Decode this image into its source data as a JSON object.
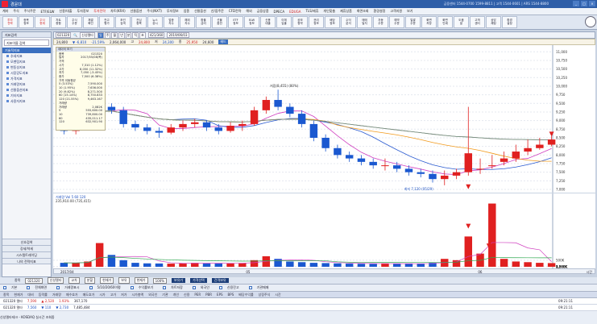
{
  "titlebar": {
    "title": "경윤대",
    "status": "금융센터 1544-0700 1599-8811 | 고객 1544-0601 | ARS 1544-8800",
    "buttons": [
      "_",
      "□",
      "×"
    ]
  },
  "menu": [
    {
      "label": "계좌",
      "hot": false
    },
    {
      "label": "주식",
      "hot": false
    },
    {
      "label": "주식주문",
      "hot": false
    },
    {
      "label": "ETF/ELW",
      "hot": false
    },
    {
      "label": "신용/대출",
      "hot": false
    },
    {
      "label": "투자정보",
      "hot": false
    },
    {
      "label": "투자전략",
      "hot": true
    },
    {
      "label": "차트(KRX)",
      "hot": false
    },
    {
      "label": "선물옵션",
      "hot": false
    },
    {
      "label": "주식(NXT)",
      "hot": false
    },
    {
      "label": "투자정보",
      "hot": false
    },
    {
      "label": "업종",
      "hot": false
    },
    {
      "label": "선물옵션",
      "hot": false
    },
    {
      "label": "선/옵주문",
      "hot": false
    },
    {
      "label": "CFD전략",
      "hot": false
    },
    {
      "label": "해외",
      "hot": false
    },
    {
      "label": "금융상품",
      "hot": false
    },
    {
      "label": "DPECA",
      "hot": false
    },
    {
      "label": "EDUGA",
      "hot": true
    },
    {
      "label": "TLS/제휴",
      "hot": false
    },
    {
      "label": "개인맞춤",
      "hot": false
    },
    {
      "label": "제휴상품",
      "hot": false
    },
    {
      "label": "화면조회",
      "hot": false
    },
    {
      "label": "환경설정",
      "hot": false
    },
    {
      "label": "고객지원",
      "hot": false
    },
    {
      "label": "보기",
      "hot": false
    }
  ],
  "toolbar": [
    {
      "line1": "투자",
      "line2": "전략",
      "hot": true
    },
    {
      "line1": "종목",
      "line2": "정보",
      "hot": false
    },
    {
      "line1": "주식",
      "line2": "현재",
      "hot": true
    },
    {
      "line1": "차트",
      "line2": "종합",
      "hot": false
    },
    {
      "line1": "주식",
      "line2": "주문",
      "hot": false
    },
    {
      "line1": "체결",
      "line2": "확인",
      "hot": false
    },
    {
      "line1": "잔고",
      "line2": "평가",
      "hot": false
    },
    {
      "line1": "조건",
      "line2": "검색",
      "hot": false
    },
    {
      "line1": "관심",
      "line2": "종목",
      "hot": false
    },
    {
      "line1": "뉴스",
      "line2": "공시",
      "hot": false
    },
    {
      "line1": "업종",
      "line2": "지수",
      "hot": false
    },
    {
      "line1": "해외",
      "line2": "지수",
      "hot": false
    },
    {
      "line1": "환율",
      "line2": "금리",
      "hot": false
    },
    {
      "line1": "선물",
      "line2": "옵션",
      "hot": false
    },
    {
      "line1": "ETF",
      "line2": "정보",
      "hot": false
    },
    {
      "line1": "ELW",
      "line2": "정보",
      "hot": false
    },
    {
      "line1": "신용",
      "line2": "대출",
      "hot": false
    },
    {
      "line1": "이체",
      "line2": "입출",
      "hot": false
    },
    {
      "line1": "공모",
      "line2": "청약",
      "hot": false
    },
    {
      "line1": "권리",
      "line2": "정보",
      "hot": false
    },
    {
      "line1": "배당",
      "line2": "정보",
      "hot": false
    },
    {
      "line1": "수익",
      "line2": "분석",
      "hot": false
    },
    {
      "line1": "매매",
      "line2": "일지",
      "hot": false
    },
    {
      "line1": "자동",
      "line2": "주문",
      "hot": false
    },
    {
      "line1": "예약",
      "line2": "주문",
      "hot": false
    },
    {
      "line1": "일괄",
      "line2": "주문",
      "hot": false
    },
    {
      "line1": "화면",
      "line2": "저장",
      "hot": false
    },
    {
      "line1": "화면",
      "line2": "인쇄",
      "hot": false
    },
    {
      "line1": "도움",
      "line2": "말",
      "hot": false
    },
    {
      "line1": "고객",
      "line2": "센터",
      "hot": false
    },
    {
      "line1": "상담",
      "line2": "채팅",
      "hot": false
    },
    {
      "line1": "환경",
      "line2": "설정",
      "hot": false
    }
  ],
  "sidebar": {
    "title": "지표검색",
    "search_placeholder": "지표이름 검색",
    "header": "기술적지표",
    "items": [
      "추세지표",
      "모멘텀지표",
      "변동성지표",
      "시장강도지표",
      "가격지표",
      "거래량지표",
      "선물옵션지표",
      "기타지표",
      "사용자지표"
    ],
    "footer": [
      "신호검색",
      "강세/약세",
      "시스템트레이딩",
      "나의 전략지표"
    ]
  },
  "chartbar": {
    "code": "021320",
    "name": "신성델타",
    "period_buttons": [
      "일",
      "주",
      "월",
      "년",
      "분",
      "틱",
      "초"
    ],
    "selected": "일",
    "count": "421/360",
    "date": "2019/06/03"
  },
  "quote": {
    "open": "24,800",
    "change": "▼ -6,810",
    "change_pct": "-21.59%",
    "volume": "2,064,000",
    "high_label": "고",
    "high": "24,800",
    "low_label": "저",
    "low": "24,300",
    "close_label": "종",
    "close": "25,950",
    "ma_value": "24,600",
    "tag": "헤드"
  },
  "infobox": {
    "title": "데이터 보기",
    "rows": [
      {
        "k": "종목",
        "v": "021320"
      },
      {
        "k": "일자",
        "v": "2017/05/08(목)"
      },
      {
        "k": "가격",
        "v": ""
      },
      {
        "k": "시가",
        "v": "7,310 (1.12%)"
      },
      {
        "k": "고가",
        "v": "8,050 (11.32%)"
      },
      {
        "k": "저가",
        "v": "7,050 (-3.45%)"
      },
      {
        "k": "종가",
        "v": "7,500 (6.38%)"
      },
      {
        "k": "가격 이동평균",
        "v": ""
      },
      {
        "k": "5 (3.53%)",
        "v": "7,590.000"
      },
      {
        "k": "10 (1.95%)",
        "v": "7,636.000"
      },
      {
        "k": "20 (9.82%)",
        "v": "8,271.500"
      },
      {
        "k": "60 (15.14%)",
        "v": "8,750.833"
      },
      {
        "k": "120 (21.55%)",
        "v": "9,463.167"
      },
      {
        "k": "거래량",
        "v": ""
      },
      {
        "k": "거래량",
        "v": "2,082K"
      },
      {
        "k": "5",
        "v": "555,600.00"
      },
      {
        "k": "10",
        "v": "739,800.00"
      },
      {
        "k": "60",
        "v": "435,011.17"
      },
      {
        "k": "120",
        "v": "632,901.90"
      }
    ]
  },
  "annotations": {
    "high": "최고 10,850 (04/13)",
    "mid": "저점(8,455) (80%)",
    "low": "최저 7,120 (05/29)",
    "vol_legend": "거래량 Vol 5 60 120",
    "vol_value": "235,910.00 (735,415)"
  },
  "price_axis": [
    "11,000",
    "10,750",
    "10,500",
    "10,250",
    "10,000",
    "9,750",
    "9,500",
    "9,250",
    "9,000",
    "8,750",
    "8,500",
    "8,250",
    "8,000",
    "7,750",
    "7,500",
    "7,250",
    "7,000"
  ],
  "vol_axis": [
    "5,000K",
    "4,500K",
    "4,000K",
    "3,500K",
    "3,000K",
    "2,500K",
    "2,000K",
    "1,500K",
    "1,000K",
    "500K"
  ],
  "xaxis": {
    "labels": [
      "2017/04",
      "05",
      "06"
    ],
    "right": "시간"
  },
  "bottom": {
    "row1": [
      "종목",
      "021320",
      "신성델타",
      "교차",
      "분할",
      "현재가",
      "보유",
      "현재가",
      "100%"
    ],
    "row1_dark": [
      "보유가",
      "가격선택",
      "간격보유"
    ],
    "row2": [
      "기본",
      "전체화면",
      "거래량표시",
      "5/10/20/60이평",
      "수익률보기",
      "차트저장"
    ],
    "row2_extra": [
      "외국인",
      "신용잔고",
      "기관매매"
    ],
    "header": [
      "종목",
      "현재가",
      "대비",
      "등락률",
      "거래량",
      "매수호가",
      "매도호가",
      "시가",
      "고가",
      "저가",
      "시가총액",
      "외국인",
      "기관",
      "개인",
      "신용",
      "PER",
      "PBR",
      "EPS",
      "BPS",
      "배당수익률",
      "상장주식",
      "시간"
    ],
    "data1": {
      "name": "021320 델타",
      "price": "7,590",
      "chg": "▲ 2,520",
      "pct": "1.93%",
      "vol": "367,170",
      "t": "09:21:11"
    },
    "data2": {
      "name": "021320 델타",
      "price": "7,560",
      "chg": "▼ 110",
      "pct": "▼ 2,730",
      "vol": "7,485,484",
      "t": "09:21:11"
    },
    "footer": "신성델타테크 - KOSDAQ 실시간 조회중"
  },
  "chart_data": {
    "type": "candlestick",
    "title": "",
    "xlabel": "",
    "ylabel": "",
    "ylim": [
      7000,
      11100
    ],
    "x": [
      "04/10",
      "04/11",
      "04/12",
      "04/13",
      "04/14",
      "04/17",
      "04/18",
      "04/19",
      "04/20",
      "04/21",
      "04/24",
      "04/25",
      "04/26",
      "04/27",
      "04/28",
      "05/01",
      "05/02",
      "05/04",
      "05/08",
      "05/10",
      "05/11",
      "05/12",
      "05/15",
      "05/16",
      "05/17",
      "05/18",
      "05/19",
      "05/22",
      "05/23",
      "05/24",
      "05/25",
      "05/26",
      "05/29",
      "05/30",
      "05/31",
      "06/01",
      "06/02",
      "06/05",
      "06/07",
      "06/08",
      "06/09",
      "06/12"
    ],
    "series": [
      {
        "name": "",
        "open": [
          9000,
          8700,
          8900,
          9200,
          9400,
          9300,
          8900,
          8800,
          8700,
          8650,
          8800,
          8900,
          8950,
          8800,
          8700,
          8850,
          8900,
          9300,
          9600,
          9400,
          9200,
          8900,
          8500,
          8200,
          8000,
          7900,
          7800,
          7700,
          7700,
          7600,
          7500,
          7450,
          7300,
          7400,
          7500,
          7600,
          7700,
          7800,
          7900,
          8100,
          8200,
          8300
        ],
        "close": [
          8700,
          8900,
          9200,
          10300,
          9300,
          8900,
          8800,
          8700,
          8650,
          8800,
          8900,
          8950,
          8800,
          8700,
          8850,
          8900,
          9300,
          9600,
          9400,
          9200,
          8900,
          8500,
          8200,
          8000,
          7900,
          7800,
          7700,
          7700,
          7600,
          7500,
          7450,
          7300,
          7400,
          7500,
          8050,
          7600,
          7700,
          7900,
          8100,
          8200,
          8300,
          8450
        ],
        "high": [
          9100,
          9000,
          9300,
          10850,
          9500,
          9400,
          9000,
          8900,
          8800,
          8900,
          9000,
          9050,
          9000,
          8900,
          8950,
          9000,
          9400,
          9700,
          9900,
          9500,
          9300,
          9000,
          8600,
          8300,
          8100,
          8000,
          7900,
          7900,
          7800,
          7700,
          7600,
          7550,
          7550,
          7600,
          9400,
          7900,
          8000,
          8100,
          8300,
          8450,
          8500,
          8550
        ],
        "low": [
          8600,
          8600,
          8800,
          9100,
          9200,
          8800,
          8700,
          8600,
          8500,
          8600,
          8700,
          8800,
          8700,
          8600,
          8650,
          8700,
          8850,
          9200,
          9300,
          9100,
          8800,
          8400,
          8100,
          7900,
          7800,
          7700,
          7600,
          7550,
          7500,
          7400,
          7350,
          7200,
          7120,
          7300,
          7400,
          7450,
          7600,
          7700,
          7800,
          8000,
          8150,
          8250
        ]
      },
      {
        "name": "",
        "volume_k": [
          300,
          280,
          400,
          1800,
          900,
          500,
          300,
          260,
          250,
          240,
          260,
          300,
          280,
          260,
          250,
          270,
          500,
          800,
          600,
          400,
          350,
          300,
          280,
          260,
          240,
          230,
          220,
          260,
          240,
          230,
          220,
          300,
          600,
          500,
          2300,
          1000,
          4800,
          600,
          400,
          350,
          300,
          280
        ]
      }
    ],
    "grid": true
  }
}
